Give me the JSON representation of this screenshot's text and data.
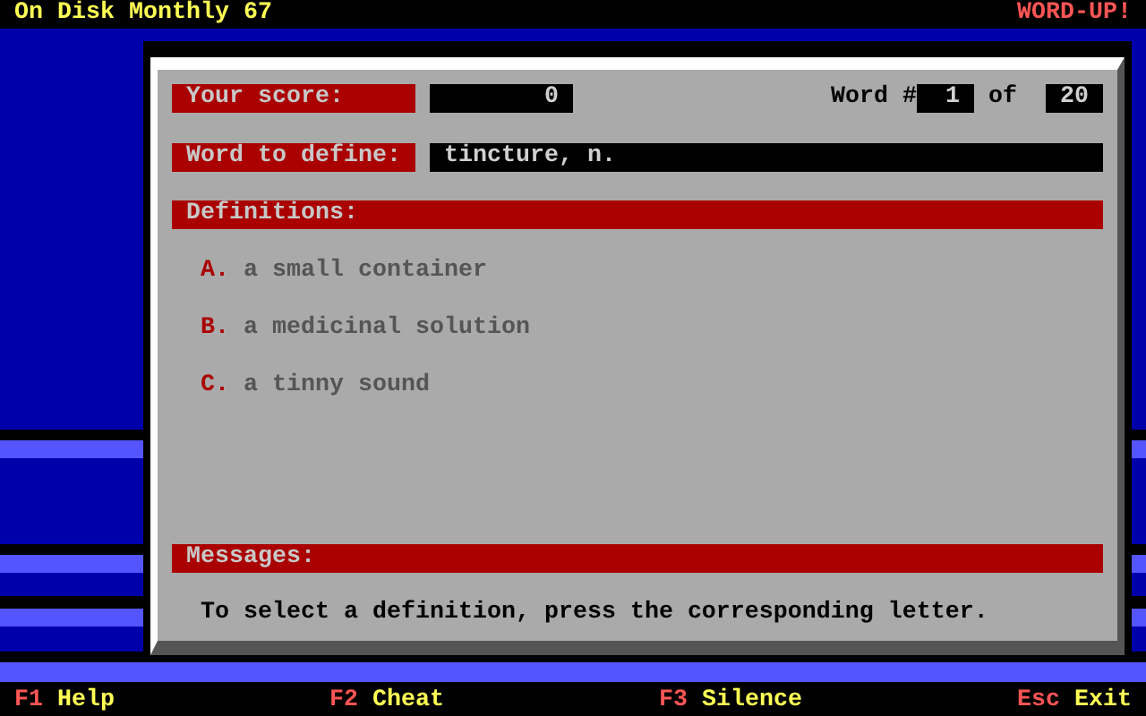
{
  "title_bar": {
    "title": "On Disk Monthly 67",
    "brand": "WORD-UP!"
  },
  "score": {
    "label": "Your score:",
    "value": "0"
  },
  "word_counter": {
    "label": "Word #",
    "current": "1",
    "separator": "of",
    "total": "20"
  },
  "word": {
    "label": "Word to define:",
    "value": "tincture, n."
  },
  "definitions": {
    "heading": "Definitions:",
    "options": [
      {
        "letter": "A.",
        "text": "a small container"
      },
      {
        "letter": "B.",
        "text": "a medicinal solution"
      },
      {
        "letter": "C.",
        "text": "a tinny sound"
      }
    ]
  },
  "messages": {
    "heading": "Messages:",
    "text": "To select a definition, press the corresponding letter."
  },
  "function_keys": [
    {
      "key": "F1",
      "label": "Help"
    },
    {
      "key": "F2",
      "label": "Cheat"
    },
    {
      "key": "F3",
      "label": "Silence"
    },
    {
      "key": "Esc",
      "label": "Exit"
    }
  ]
}
